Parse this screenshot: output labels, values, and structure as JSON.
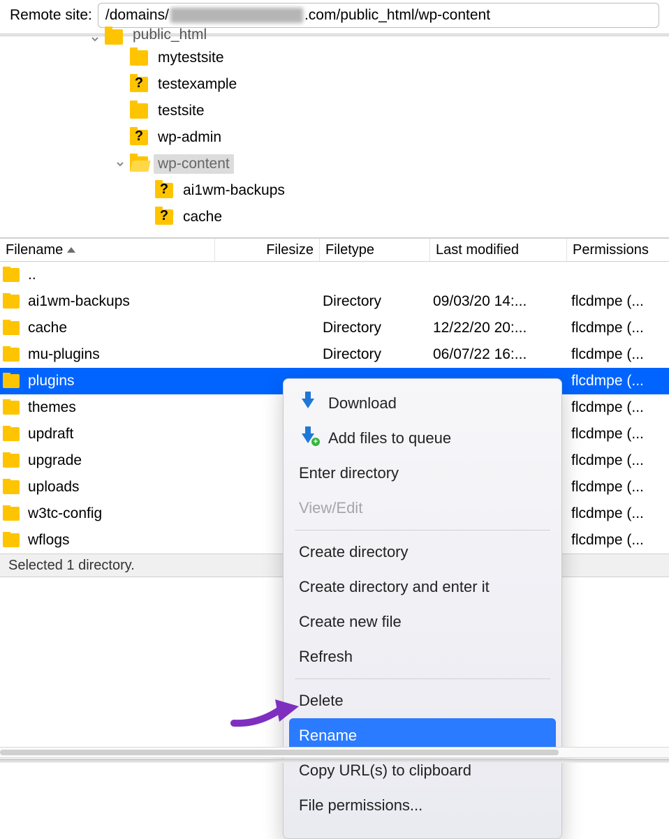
{
  "pathbar": {
    "label": "Remote site:",
    "path_prefix": "/domains/",
    "path_suffix": ".com/public_html/wp-content"
  },
  "tree": {
    "root": {
      "label": "public_html",
      "icon": "folder",
      "indent": 150,
      "expander": "none",
      "cutoff": true
    },
    "items": [
      {
        "label": "mytestsite",
        "icon": "folder",
        "indent": 186,
        "expander": "none"
      },
      {
        "label": "testexample",
        "icon": "qfolder",
        "indent": 186,
        "expander": "none"
      },
      {
        "label": "testsite",
        "icon": "folder",
        "indent": 186,
        "expander": "none"
      },
      {
        "label": "wp-admin",
        "icon": "qfolder",
        "indent": 186,
        "expander": "none"
      },
      {
        "label": "wp-content",
        "icon": "ofolder",
        "indent": 186,
        "expander": "down",
        "selected": true
      },
      {
        "label": "ai1wm-backups",
        "icon": "qfolder",
        "indent": 222,
        "expander": "none"
      },
      {
        "label": "cache",
        "icon": "qfolder",
        "indent": 222,
        "expander": "none"
      }
    ]
  },
  "columns": {
    "filename": "Filename",
    "filesize": "Filesize",
    "filetype": "Filetype",
    "lastmodified": "Last modified",
    "permissions": "Permissions"
  },
  "files": [
    {
      "name": "..",
      "filesize": "",
      "filetype": "",
      "modified": "",
      "perm": "",
      "selected": false
    },
    {
      "name": "ai1wm-backups",
      "filesize": "",
      "filetype": "Directory",
      "modified": "09/03/20 14:...",
      "perm": "flcdmpe (...",
      "selected": false
    },
    {
      "name": "cache",
      "filesize": "",
      "filetype": "Directory",
      "modified": "12/22/20 20:...",
      "perm": "flcdmpe (...",
      "selected": false
    },
    {
      "name": "mu-plugins",
      "filesize": "",
      "filetype": "Directory",
      "modified": "06/07/22 16:...",
      "perm": "flcdmpe (...",
      "selected": false
    },
    {
      "name": "plugins",
      "filesize": "",
      "filetype": "",
      "modified": "",
      "perm": "flcdmpe (...",
      "selected": true
    },
    {
      "name": "themes",
      "filesize": "",
      "filetype": "",
      "modified": "",
      "perm": "flcdmpe (...",
      "selected": false
    },
    {
      "name": "updraft",
      "filesize": "",
      "filetype": "",
      "modified": "",
      "perm": "flcdmpe (...",
      "selected": false
    },
    {
      "name": "upgrade",
      "filesize": "",
      "filetype": "",
      "modified": "",
      "perm": "flcdmpe (...",
      "selected": false
    },
    {
      "name": "uploads",
      "filesize": "",
      "filetype": "",
      "modified": "",
      "perm": "flcdmpe (...",
      "selected": false
    },
    {
      "name": "w3tc-config",
      "filesize": "",
      "filetype": "",
      "modified": "",
      "perm": "flcdmpe (...",
      "selected": false
    },
    {
      "name": "wflogs",
      "filesize": "",
      "filetype": "",
      "modified": "",
      "perm": "flcdmpe (...",
      "selected": false
    }
  ],
  "status": "Selected 1 directory.",
  "context_menu": {
    "download": "Download",
    "add_queue": "Add files to queue",
    "enter_dir": "Enter directory",
    "view_edit": "View/Edit",
    "create_dir": "Create directory",
    "create_dir_enter": "Create directory and enter it",
    "create_file": "Create new file",
    "refresh": "Refresh",
    "delete": "Delete",
    "rename": "Rename",
    "copy_url": "Copy URL(s) to clipboard",
    "file_perm": "File permissions..."
  }
}
